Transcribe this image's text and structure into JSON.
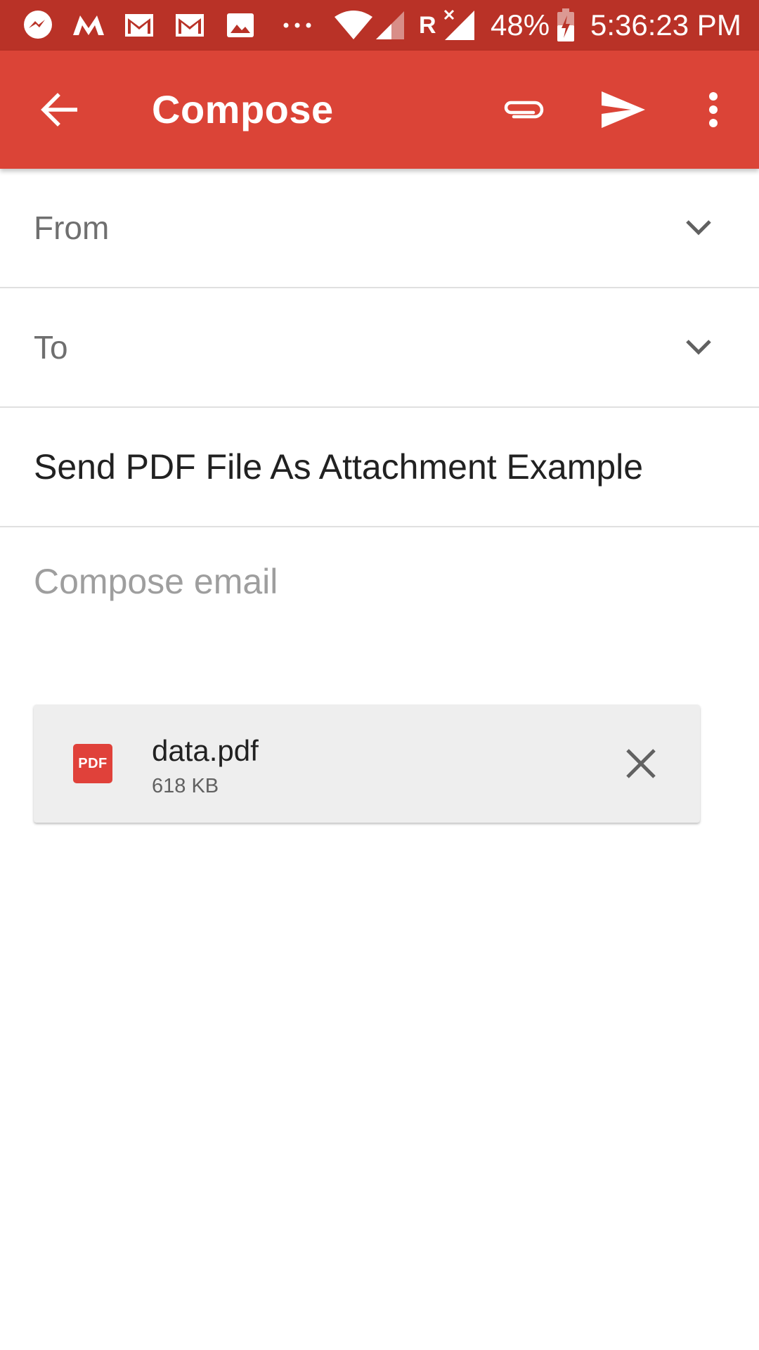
{
  "status_bar": {
    "notification_icons": [
      "messenger-icon",
      "m-logo-icon",
      "gmail-icon",
      "gmail-icon",
      "gallery-icon",
      "more-dots-icon"
    ],
    "roaming_label": "R",
    "battery_percent": "48%",
    "time": "5:36:23 PM"
  },
  "app_bar": {
    "title": "Compose",
    "background_color": "#db4437",
    "icons": {
      "back": "arrow-back-icon",
      "attach": "paperclip-icon",
      "send": "send-icon",
      "more": "more-vert-icon"
    }
  },
  "form": {
    "from_label": "From",
    "to_label": "To",
    "subject": "Send PDF File As Attachment Example",
    "body_placeholder": "Compose email"
  },
  "attachment": {
    "file_type_label": "PDF",
    "file_name": "data.pdf",
    "file_size": "618 KB",
    "icon_color": "#e0413a"
  }
}
